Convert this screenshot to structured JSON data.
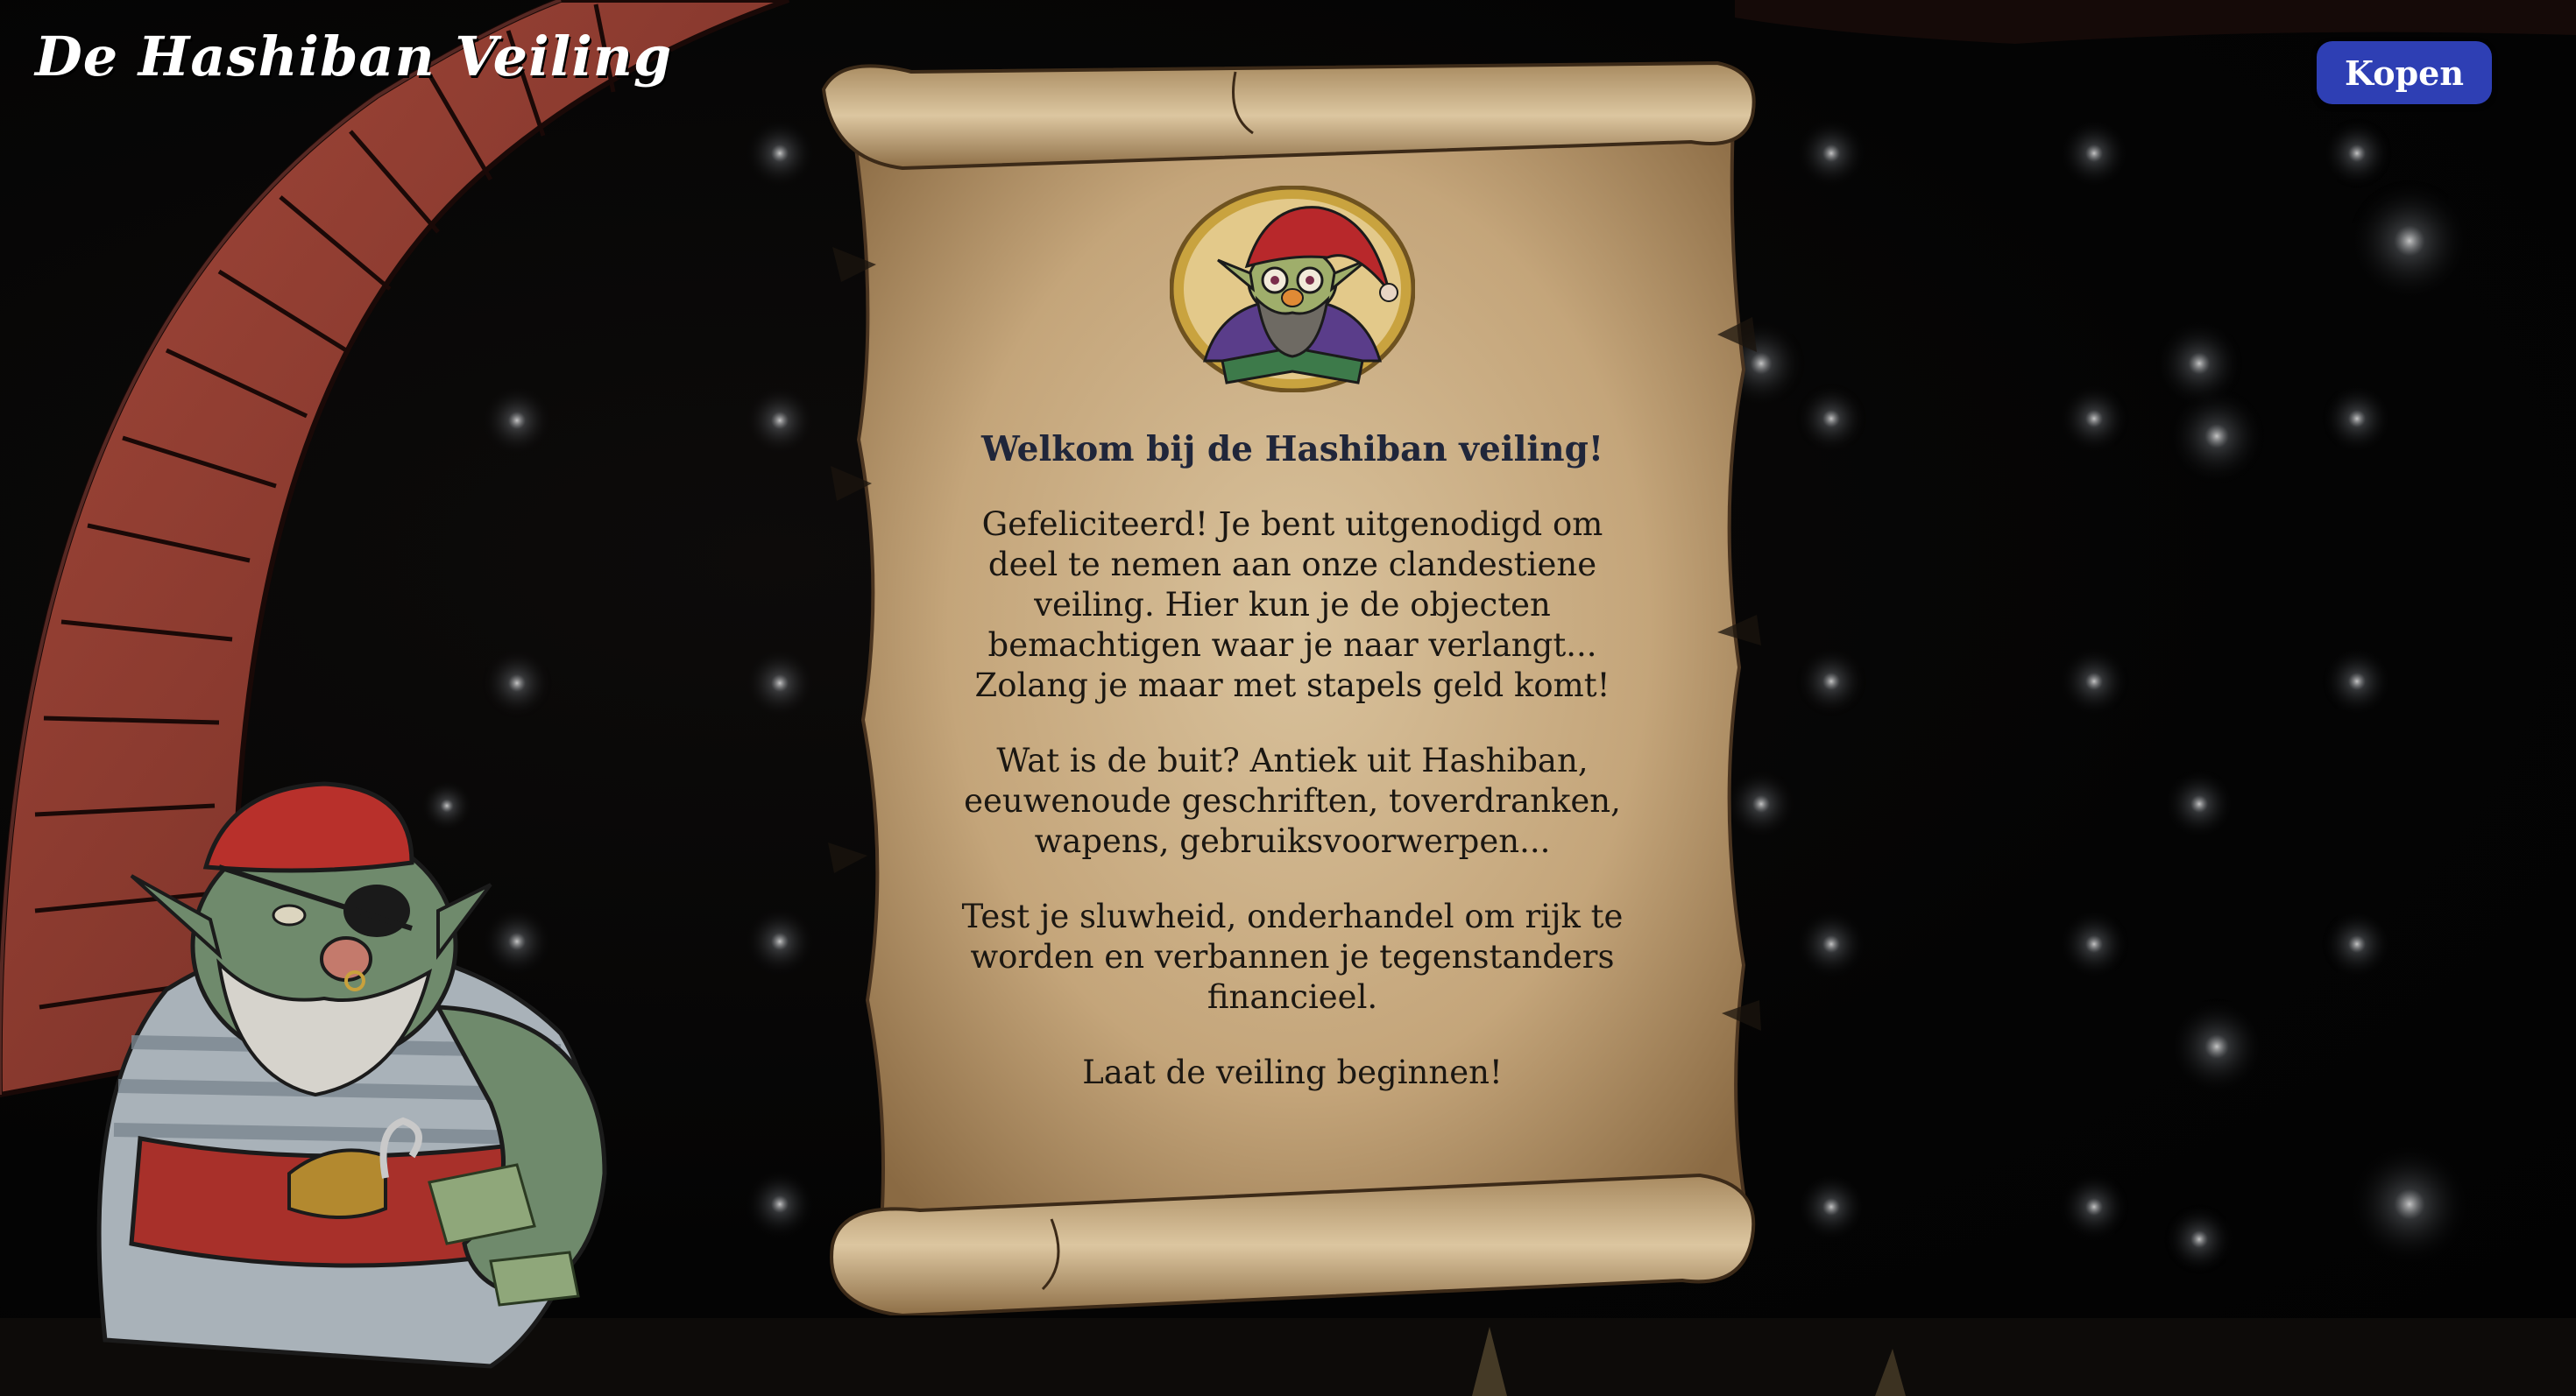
{
  "app": {
    "title": "De Hashiban Veiling"
  },
  "header": {
    "buy_label": "Kopen"
  },
  "scroll": {
    "title": "Welkom bij de Hashiban veiling!",
    "paragraphs": [
      "Gefeliciteerd! Je bent uitgenodigd om deel te nemen aan onze clandestiene veiling. Hier kun je de objecten bemachtigen waar je naar verlangt... Zolang je maar met stapels geld komt!",
      "Wat is de buit? Antiek uit Hashiban, eeuwenoude geschriften, toverdranken, wapens, gebruiksvoorwerpen...",
      "Test je sluwheid, onderhandel om rijk te worden en verbannen je tegenstanders financieel.",
      "Laat de veiling beginnen!"
    ]
  },
  "colors": {
    "button": "#2e3fb4",
    "parchment": "#c8ad84",
    "title_text": "#20263a",
    "background": "#050505"
  },
  "icons": {
    "avatar": "gnome-reading-book-portrait",
    "pirate": "pirate-goblin-illustration",
    "arch": "brick-arch-illustration"
  }
}
